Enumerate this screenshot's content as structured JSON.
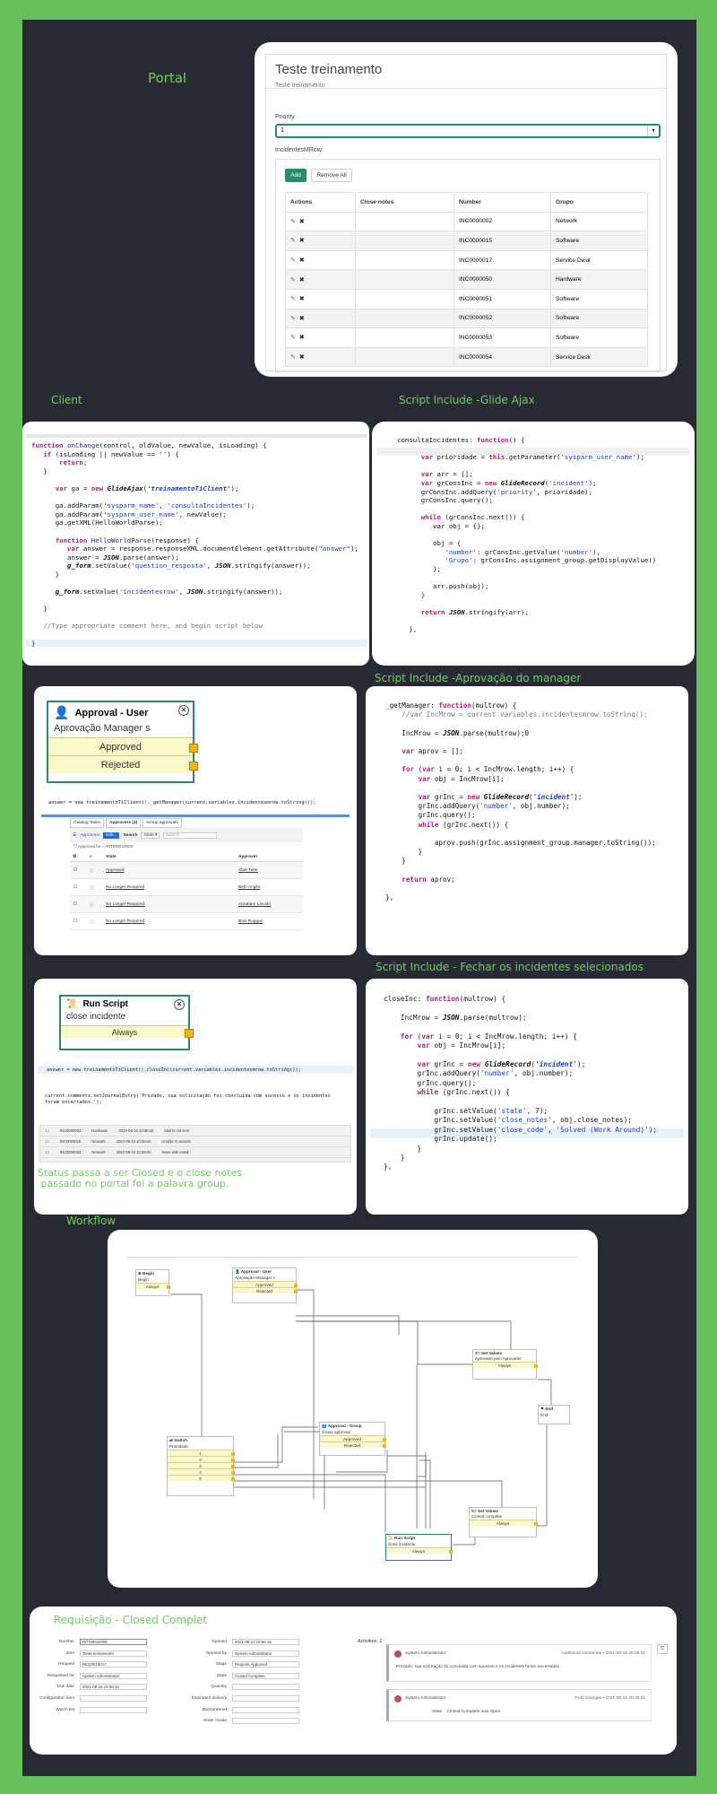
{
  "sections": {
    "portal": "Portal",
    "client": "Client",
    "script_ajax": "Script Include -Glide Ajax",
    "script_manager": "Script Include -Aprovação do manager",
    "script_fechar": "Script Include - Fechar os incidentes selecionados",
    "workflow": "Workflow",
    "requisicao": "Requisição - Closed Complet",
    "status_note": "Status passa a ser Closed e o close notes\n passado no portal foi a palavra group."
  },
  "portal": {
    "title": "Teste treinamento",
    "subtitle": "Teste treinamento",
    "priority_label": "Priority",
    "priority_value": "1",
    "incidents_label": "IncidentesMRow",
    "add": "Add",
    "remove_all": "Remove All",
    "columns": [
      "Actions",
      "Close notes",
      "Number",
      "Grupo"
    ],
    "rows": [
      {
        "number": "INC0000002",
        "grupo": "Network"
      },
      {
        "number": "INC0000015",
        "grupo": "Software"
      },
      {
        "number": "INC0000017",
        "grupo": "Service Desk"
      },
      {
        "number": "INC0000050",
        "grupo": "Hardware"
      },
      {
        "number": "INC0000051",
        "grupo": "Software"
      },
      {
        "number": "INC0000052",
        "grupo": "Software"
      },
      {
        "number": "INC0000053",
        "grupo": "Software"
      },
      {
        "number": "INC0000054",
        "grupo": "Service Desk"
      }
    ]
  },
  "approval": {
    "title": "Approval - User",
    "subtitle": "Aprovação Manager s",
    "approved": "Approved",
    "rejected": "Rejected",
    "code_line": "answer = new treinamentoTiClient()._getManager(current.variables.incidentesmrow.toString());",
    "tabs": [
      "Catalog Tasks",
      "Approvers (4)",
      "Group approvals"
    ],
    "toolbar": {
      "menu": "Approvers",
      "edit": "Edit...",
      "search": "Search",
      "state": "State",
      "search_placeholder": "Search"
    },
    "filter": "Approval for = RITM0010000",
    "col_state": "State",
    "col_approver": "Approver",
    "rows": [
      {
        "state": "Approved",
        "approver": "Abel Tuter"
      },
      {
        "state": "No Longer Required",
        "approver": "Beth Anglin"
      },
      {
        "state": "No Longer Required",
        "approver": "Abraham Lincoln"
      },
      {
        "state": "No Longer Required",
        "approver": "Bow Ruggeri"
      }
    ]
  },
  "runscript": {
    "title": "Run Script",
    "subtitle": "close incidente",
    "always": "Always",
    "code1": "answer = new treinamentoTiClient().closeInc(current.variables.incidentesmrow.toString());",
    "code2": "current.comments.setJournalEntry('Prezado, sua solicitação foi concluída com sucesso e os incidentes foram encerrados.');",
    "rows": [
      [
        "INC0000002",
        "Hardware",
        "2022-08-15 10:38:46",
        "Mail is not sent"
      ],
      [
        "INC0000015",
        "Network",
        "2022-08-15 10:38:46",
        "Unable to access"
      ],
      [
        "INC0000052",
        "Network",
        "2022-08-15 10:38:46",
        "Issue with email"
      ]
    ]
  },
  "workflow": {
    "begin": "Begin",
    "begin_sub": "Begin",
    "begin_row": "Always",
    "approval": "Approval - User",
    "approval_sub": "Aprovação Manager s",
    "approved": "Approved",
    "rejected": "Rejected",
    "setvalues1": "Set Values",
    "setvalues1_sub": "Aprovado pelo Aprovador",
    "always1": "Always",
    "end": "End",
    "end_sub": "End",
    "switch": "Switch",
    "switch_sub": "Prioridade",
    "switch_rows": [
      "1",
      "2",
      "3",
      "4",
      "5"
    ],
    "group": "Approval - Group",
    "group_sub": "Group approval",
    "group_approved": "Approved",
    "group_rejected": "Rejected",
    "setvalues2": "Set Values",
    "setvalues2_sub": "Closed complete",
    "always2": "Always",
    "runscript": "Run Script",
    "runscript_sub": "close incidente",
    "always3": "Always"
  },
  "requisicao": {
    "left_fields": [
      {
        "label": "Number",
        "value": "RITM0010000"
      },
      {
        "label": "Item",
        "value": "Teste treinamento"
      },
      {
        "label": "Request",
        "value": "REQ0010017"
      },
      {
        "label": "Requested for",
        "value": "System Administrator"
      },
      {
        "label": "Due date",
        "value": "2021-08-16 15:56:16"
      },
      {
        "label": "Configuration item",
        "value": ""
      },
      {
        "label": "Watch list",
        "value": ""
      }
    ],
    "right_fields": [
      {
        "label": "Opened",
        "value": "2021-08-13 15:56:16"
      },
      {
        "label": "Opened by",
        "value": "System Administrator"
      },
      {
        "label": "Stage",
        "value": "Request Approved"
      },
      {
        "label": "State",
        "value": "Closed Complete"
      },
      {
        "label": "Quantity",
        "value": ""
      },
      {
        "label": "Estimated delivery",
        "value": ""
      },
      {
        "label": "Backordered",
        "value": ""
      },
      {
        "label": "Order Guide",
        "value": ""
      }
    ],
    "activities": "Activities: 2",
    "entries": [
      {
        "user": "System Administrator",
        "kind": "Additional comments",
        "time": "2021-08-15 20:38:01",
        "text": "Prezado, sua solicitação foi concluída com sucesso e os incidentes foram encerrados."
      },
      {
        "user": "System Administrator",
        "kind": "Field changes",
        "time": "2021-08-15 20:38:01",
        "state_label": "State",
        "state_value": "Closed Complete  was Open"
      }
    ]
  }
}
